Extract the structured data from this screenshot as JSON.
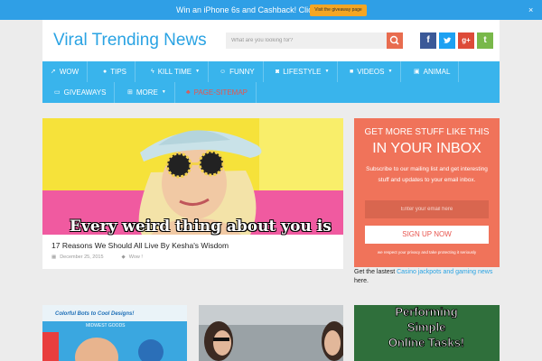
{
  "promo": {
    "text": "Win an iPhone 6s and Cashback! Click Here",
    "button": "Visit the giveaway page",
    "close": "×"
  },
  "header": {
    "logo": "Viral Trending News",
    "search_placeholder": "What are you looking for?",
    "social": [
      "f",
      "t",
      "g+",
      "t"
    ]
  },
  "nav": {
    "items": [
      {
        "label": "WOW",
        "icon": "rocket-icon"
      },
      {
        "label": "TIPS",
        "icon": "bulb-icon"
      },
      {
        "label": "KILL TIME",
        "icon": "bolt-icon"
      },
      {
        "label": "FUNNY",
        "icon": "smile-icon"
      },
      {
        "label": "LIFESTYLE",
        "icon": "camera-icon"
      },
      {
        "label": "VIDEOS",
        "icon": "video-icon"
      },
      {
        "label": "ANIMAL",
        "icon": "image-icon"
      },
      {
        "label": "GIVEAWAYS",
        "icon": "money-icon"
      },
      {
        "label": "MORE",
        "icon": "plus-icon"
      },
      {
        "label": "PAGE-SITEMAP",
        "icon": "sitemap-icon"
      }
    ]
  },
  "featured": {
    "caption": "Every weird thing about you is",
    "title": "17 Reasons We Should All Live By Kesha's Wisdom",
    "date": "December 25, 2015",
    "tag": "Wow !"
  },
  "newsletter": {
    "heading": "GET MORE STUFF LIKE THIS",
    "big": "IN YOUR INBOX",
    "desc": "Subscribe to our mailing list and get interesting stuff and updates to your email inbox.",
    "email_placeholder": "Enter your email here",
    "button": "SIGN UP NOW",
    "note": "we respect your privacy and take protecting it seriously"
  },
  "casino": {
    "prefix": "Get the lastest ",
    "link": "Casino jackpots and gaming news",
    "suffix": " here."
  },
  "thumbs": {
    "one_text": "Colorful Bots to Cool Designs!",
    "one_sub": "MIDWEST GOODS",
    "three_text": "Performing Simple Online Tasks!"
  },
  "colors": {
    "promo": "#2f9fe6",
    "nav": "#39b4ec",
    "newsletter": "#f0735a",
    "logo": "#2aa3e3"
  }
}
